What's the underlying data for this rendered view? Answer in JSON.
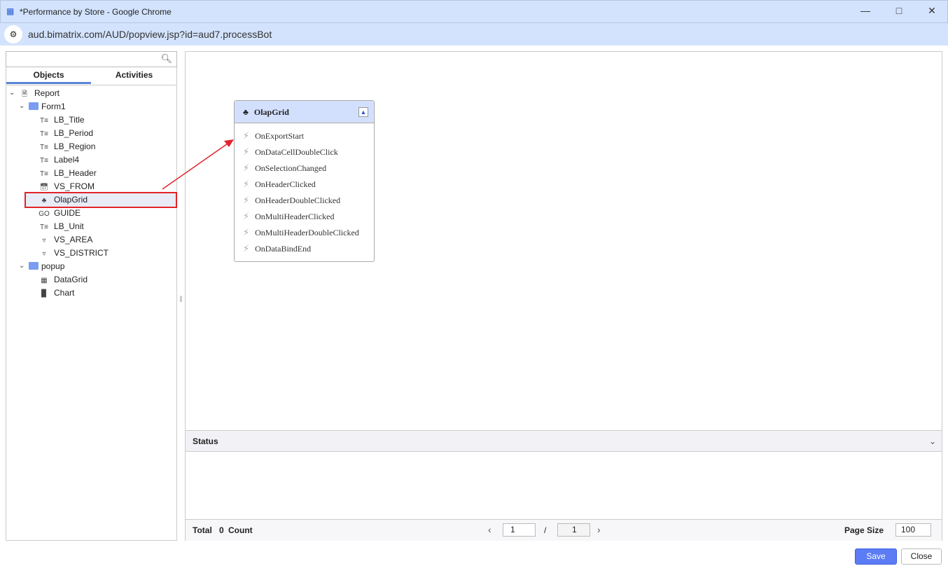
{
  "window": {
    "title": "*Performance by Store - Google Chrome",
    "url": "aud.bimatrix.com/AUD/popview.jsp?id=aud7.processBot"
  },
  "left": {
    "search_placeholder": "",
    "tabs": [
      "Objects",
      "Activities"
    ],
    "tree": [
      {
        "label": "Report",
        "icon": "document-icon",
        "level": 0
      },
      {
        "label": "Form1",
        "icon": "folder-icon",
        "level": 1
      },
      {
        "label": "LB_Title",
        "icon": "label-icon",
        "level": 2
      },
      {
        "label": "LB_Period",
        "icon": "label-icon",
        "level": 2
      },
      {
        "label": "LB_Region",
        "icon": "label-icon",
        "level": 2
      },
      {
        "label": "Label4",
        "icon": "label-icon",
        "level": 2
      },
      {
        "label": "LB_Header",
        "icon": "label-icon",
        "level": 2
      },
      {
        "label": "VS_FROM",
        "icon": "calendar-icon",
        "level": 2
      },
      {
        "label": "OlapGrid",
        "icon": "olap-icon",
        "level": 2,
        "selected": true
      },
      {
        "label": "GUIDE",
        "icon": "button-icon",
        "level": 2
      },
      {
        "label": "LB_Unit",
        "icon": "label-icon",
        "level": 2
      },
      {
        "label": "VS_AREA",
        "icon": "combo-icon",
        "level": 2
      },
      {
        "label": "VS_DISTRICT",
        "icon": "combo-icon",
        "level": 2
      },
      {
        "label": "popup",
        "icon": "folder-icon",
        "level": 1
      },
      {
        "label": "DataGrid",
        "icon": "grid-icon",
        "level": 2
      },
      {
        "label": "Chart",
        "icon": "chart-icon",
        "level": 2
      }
    ]
  },
  "card": {
    "title": "OlapGrid",
    "events": [
      "OnExportStart",
      "OnDataCellDoubleClick",
      "OnSelectionChanged",
      "OnHeaderClicked",
      "OnHeaderDoubleClicked",
      "OnMultiHeaderClicked",
      "OnMultiHeaderDoubleClicked",
      "OnDataBindEnd"
    ]
  },
  "status": {
    "title": "Status",
    "total_label": "Total",
    "count": "0",
    "count_label": "Count",
    "page": "1",
    "sep": "/",
    "pages": "1",
    "page_size_label": "Page Size",
    "page_size": "100"
  },
  "buttons": {
    "save": "Save",
    "close": "Close"
  },
  "colors": {
    "accent": "#5b7cf5",
    "highlight": "#e0242a"
  }
}
